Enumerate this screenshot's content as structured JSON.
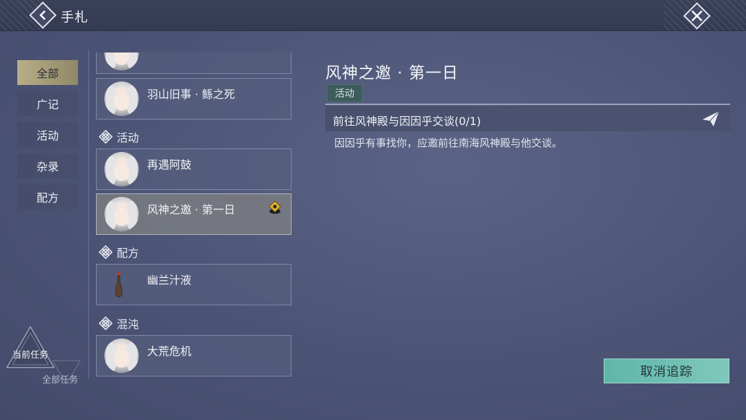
{
  "header": {
    "title": "手札",
    "back_icon": "chevron-left-icon",
    "close_icon": "close-icon"
  },
  "categories": [
    {
      "label": "全部",
      "active": true
    },
    {
      "label": "广记",
      "active": false
    },
    {
      "label": "活动",
      "active": false
    },
    {
      "label": "杂录",
      "active": false
    },
    {
      "label": "配方",
      "active": false
    }
  ],
  "quest_list": {
    "cards": [
      {
        "name": "",
        "icon": "portrait",
        "partial": true
      },
      {
        "name": "羽山旧事 · 鲧之死",
        "icon": "portrait"
      },
      {
        "name": "再遇阿鼓",
        "icon": "portrait"
      },
      {
        "name": "风神之邀 · 第一日",
        "icon": "portrait",
        "selected": true,
        "tracked": true
      },
      {
        "name": "幽兰汁液",
        "icon": "vase"
      },
      {
        "name": "大荒危机",
        "icon": "portrait"
      }
    ],
    "sections": [
      {
        "label": "活动",
        "icon": "knot-icon"
      },
      {
        "label": "配方",
        "icon": "knot-icon"
      },
      {
        "label": "混沌",
        "icon": "knot-icon"
      }
    ]
  },
  "detail": {
    "title": "风神之邀 · 第一日",
    "tag": "活动",
    "objective": "前往风神殿与因因乎交谈(0/1)",
    "description": "因因乎有事找你，应邀前往南海风神殿与他交谈。",
    "objective_icon": "paper-plane-icon"
  },
  "actions": {
    "cancel_tracking": "取消追踪"
  },
  "mode_toggle": {
    "current": "当前任务",
    "all": "全部任务"
  },
  "colors": {
    "accent_teal": "#6fbfb1",
    "active_tab": "#b8ae88",
    "background": "#4c5476"
  }
}
